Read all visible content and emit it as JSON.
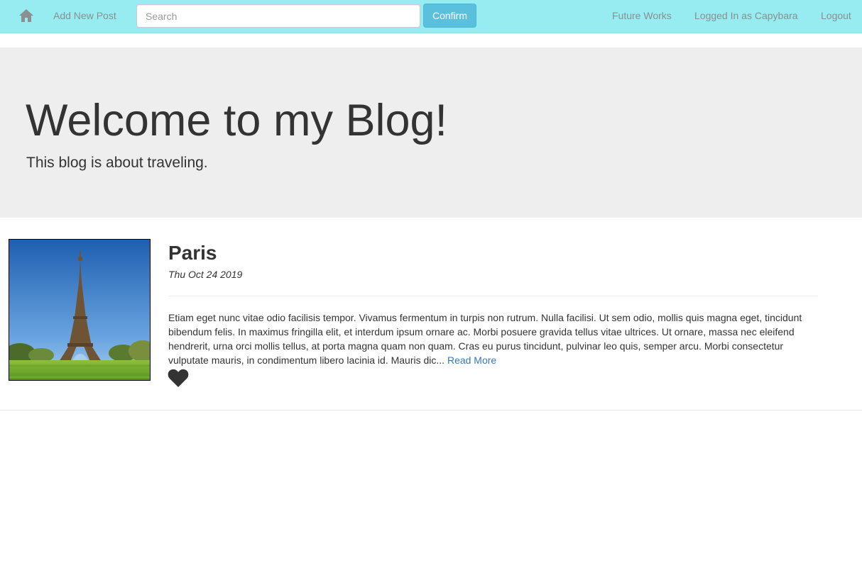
{
  "navbar": {
    "home_icon": "home-icon",
    "add_post": "Add New Post",
    "search_placeholder": "Search",
    "confirm": "Confirm",
    "future_works": "Future Works",
    "logged_in": "Logged In as Capybara",
    "logout": "Logout",
    "background": "#96ecf1",
    "confirm_color": "#5bc0de"
  },
  "jumbotron": {
    "title": "Welcome to my Blog!",
    "subtitle": "This blog is about traveling."
  },
  "posts": [
    {
      "title": "Paris",
      "date": "Thu Oct 24 2019",
      "image_subject": "eiffel-tower-photo",
      "excerpt": "Etiam eget nunc vitae odio facilisis tempor. Vivamus fermentum in turpis non rutrum. Nulla facilisi. Ut sem odio, mollis quis magna eget, tincidunt bibendum felis. In maximus fringilla elit, et interdum ipsum ornare ac. Morbi posuere gravida tellus vitae ultrices. Ut ornare, massa nec eleifend hendrerit, urna orci mollis tellus, at porta magna quam non quam. Cras eu purus tincidunt, pulvinar leo quis, semper arcu. Morbi consectetur vulputate mauris, in condimentum libero lacinia id. Mauris dic...",
      "read_more": "Read More",
      "like_icon": "heart-icon"
    }
  ]
}
